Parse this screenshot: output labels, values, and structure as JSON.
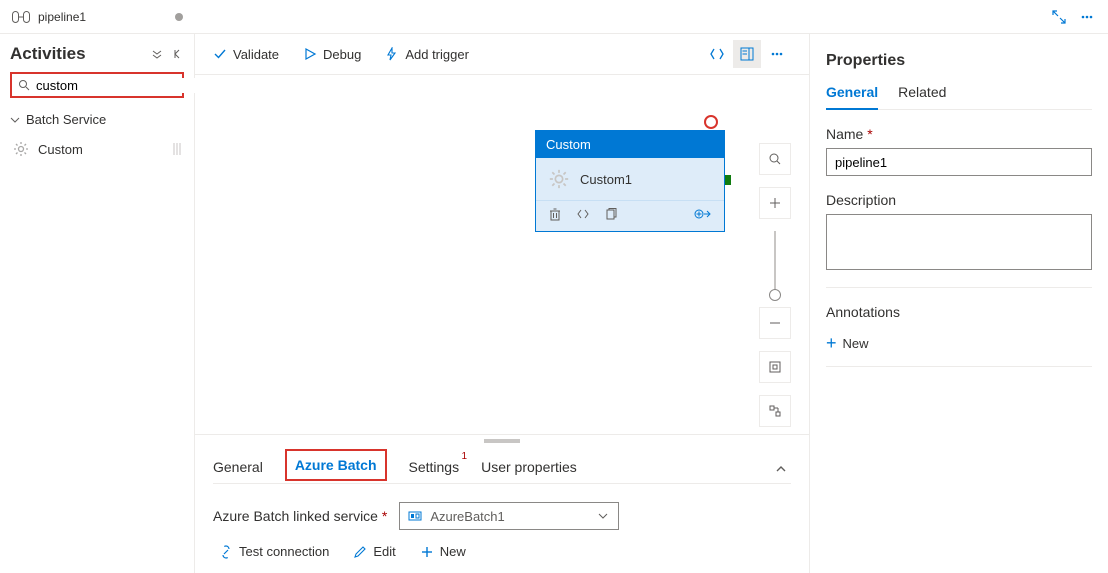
{
  "tab": {
    "name": "pipeline1"
  },
  "sidebar": {
    "title": "Activities",
    "search_value": "custom",
    "group_label": "Batch Service",
    "item_label": "Custom"
  },
  "toolbar": {
    "validate": "Validate",
    "debug": "Debug",
    "add_trigger": "Add trigger"
  },
  "node": {
    "type_label": "Custom",
    "name": "Custom1"
  },
  "bottom_panel": {
    "tabs": {
      "general": "General",
      "azure_batch": "Azure Batch",
      "settings": "Settings",
      "settings_badge": "1",
      "user_properties": "User properties"
    },
    "linked_service_label": "Azure Batch linked service",
    "linked_service_value": "AzureBatch1",
    "actions": {
      "test_connection": "Test connection",
      "edit": "Edit",
      "new": "New"
    }
  },
  "properties": {
    "title": "Properties",
    "tabs": {
      "general": "General",
      "related": "Related"
    },
    "name_label": "Name",
    "name_value": "pipeline1",
    "description_label": "Description",
    "annotations_label": "Annotations",
    "new_label": "New"
  }
}
